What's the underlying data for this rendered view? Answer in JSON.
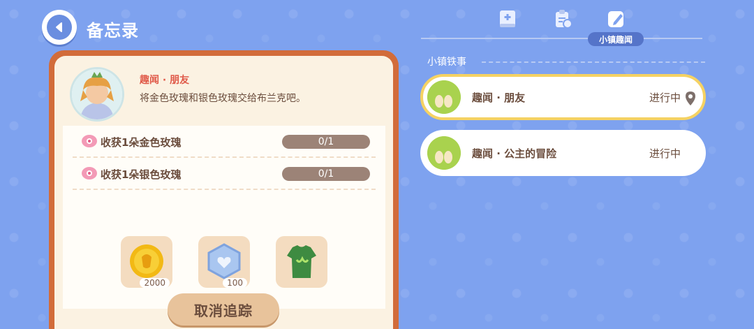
{
  "header": {
    "title": "备忘录",
    "back_icon": "back-arrow-icon"
  },
  "quest": {
    "title": "趣闻 · 朋友",
    "description": "将金色玫瑰和银色玫瑰交给布兰克吧。",
    "objectives": [
      {
        "label": "收获1朵金色玫瑰",
        "progress": "0/1"
      },
      {
        "label": "收获1朵银色玫瑰",
        "progress": "0/1"
      }
    ],
    "rewards": [
      {
        "icon": "gold-coin-icon",
        "count": "2000"
      },
      {
        "icon": "blue-badge-icon",
        "count": "100"
      },
      {
        "icon": "green-shirt-icon",
        "count": ""
      }
    ],
    "cancel_label": "取消追踪"
  },
  "tabs": [
    {
      "icon": "book-plus-icon"
    },
    {
      "icon": "clipboard-refresh-icon"
    },
    {
      "icon": "note-edit-icon",
      "label": "小镇趣闻"
    }
  ],
  "list": {
    "section_title": "小镇铁事",
    "items": [
      {
        "title": "趣闻 · 朋友",
        "status": "进行中",
        "selected": true
      },
      {
        "title": "趣闻 · 公主的冒险",
        "status": "进行中",
        "selected": false
      }
    ]
  },
  "colors": {
    "background": "#7ea2ef",
    "card_border": "#d26c3a",
    "quest_title": "#e05a49",
    "selected_outline": "#f5d263"
  }
}
